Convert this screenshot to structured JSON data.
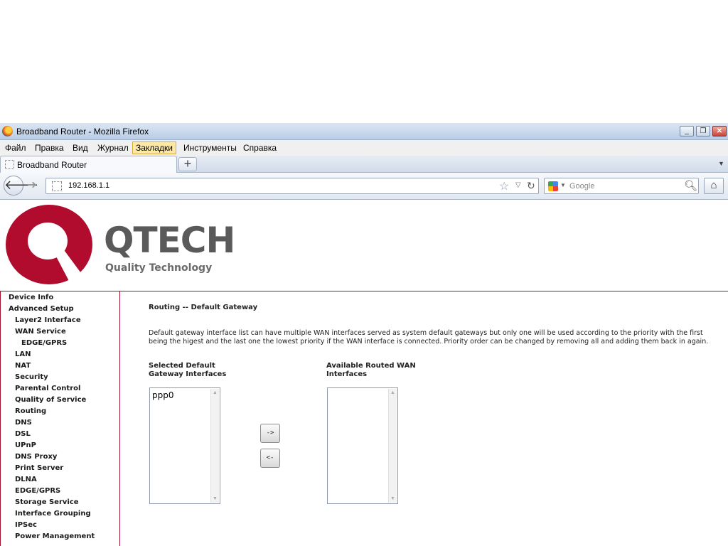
{
  "window": {
    "title": "Broadband Router - Mozilla Firefox"
  },
  "menu": [
    "Файл",
    "Правка",
    "Вид",
    "Журнал",
    "Закладки",
    "Инструменты",
    "Справка"
  ],
  "tab": {
    "label": "Broadband Router",
    "new_tab": "+"
  },
  "navbar": {
    "url": "192.168.1.1",
    "search_placeholder": "Google"
  },
  "logo": {
    "name": "QTECH",
    "tagline": "Quality Technology"
  },
  "sidebar": [
    "Device Info",
    "Advanced Setup",
    "Layer2 Interface",
    "WAN Service",
    "EDGE/GPRS",
    "LAN",
    "NAT",
    "Security",
    "Parental Control",
    "Quality of Service",
    "Routing",
    "DNS",
    "DSL",
    "UPnP",
    "DNS Proxy",
    "Print Server",
    "DLNA",
    "EDGE/GPRS",
    "Storage Service",
    "Interface Grouping",
    "IPSec",
    "Power Management"
  ],
  "main": {
    "heading": "Routing -- Default Gateway",
    "description": "Default gateway interface list can have multiple WAN interfaces served as system default gateways but only one will be used according to the priority with the first being the higest and the last one the lowest priority if the WAN interface is connected. Priority order can be changed by removing all and adding them back in again.",
    "selected_label": "Selected Default Gateway Interfaces",
    "available_label": "Available Routed WAN Interfaces",
    "selected_items": [
      "ppp0"
    ],
    "available_items": [],
    "add_button": "->",
    "remove_button": "<-"
  }
}
